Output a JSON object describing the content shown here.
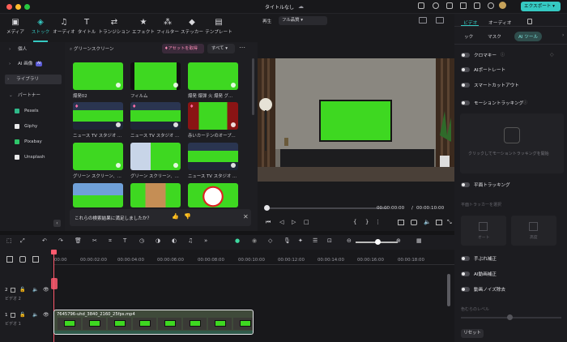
{
  "titlebar": {
    "title": "タイトルなし",
    "export_label": "エクスポート"
  },
  "toolbar": {
    "items": [
      {
        "label": "メディア",
        "icon": "media-icon"
      },
      {
        "label": "ストック",
        "icon": "stock-icon"
      },
      {
        "label": "オーディオ",
        "icon": "audio-icon"
      },
      {
        "label": "タイトル",
        "icon": "title-icon"
      },
      {
        "label": "トランジション",
        "icon": "transition-icon"
      },
      {
        "label": "エフェクト",
        "icon": "effect-icon"
      },
      {
        "label": "フィルター",
        "icon": "filter-icon"
      },
      {
        "label": "ステッカー",
        "icon": "sticker-icon"
      },
      {
        "label": "テンプレート",
        "icon": "template-icon"
      }
    ]
  },
  "sidebar": {
    "personal": "個人",
    "ai_image": "AI 画像",
    "ai_badge": "AI",
    "library": "ライブラリ",
    "partners": "パートナー",
    "providers": [
      "Pexels",
      "Giphy",
      "Pixabay",
      "Unsplash"
    ]
  },
  "search": {
    "value": "グリーンスクリーン",
    "asset_button": "アセットを取得",
    "filter": "すべて"
  },
  "assets": [
    {
      "caption": "爆発02"
    },
    {
      "caption": "フィルム"
    },
    {
      "caption": "爆発 爆弾 火 爆発 グ..."
    },
    {
      "caption": "ニュース TV スタジオ ..."
    },
    {
      "caption": "ニュース TV スタジオ ..."
    },
    {
      "caption": "赤いカーテンのオープ..."
    },
    {
      "caption": "グリーン スクリーン、..."
    },
    {
      "caption": "グリーン スクリーン、..."
    },
    {
      "caption": "ニュース TV スタジオ ..."
    }
  ],
  "feedback": {
    "question": "これらの検索結果に満足しましたか？"
  },
  "preview": {
    "tab": "再生",
    "quality": "フル品質",
    "current_time": "00:00:00:00",
    "separator": "/",
    "total_time": "00:00:10:00"
  },
  "right_panel": {
    "tabs": [
      "ビデオ",
      "オーディオ"
    ],
    "subtabs": [
      "ック",
      "マスク",
      "AI ツール"
    ],
    "tools": [
      "クロマキー",
      "AIポートレート",
      "スマートカットアウト",
      "モーショントラッキング"
    ],
    "tracking_hint": "クリックしてモーショントラッキングを開始",
    "plane_tracking": "平面トラッキング",
    "plane_select": "平面トラッカーを選択",
    "option_auto": "オート",
    "option_advanced": "高度",
    "tools2": [
      "手ぶれ補正",
      "AI動画補正",
      "動画ノイズ除去"
    ],
    "level_label": "色むらのレベル",
    "reset": "リセット"
  },
  "timeline": {
    "ticks": [
      "00:00",
      "00:00:02:00",
      "00:00:04:00",
      "00:00:06:00",
      "00:00:08:00",
      "00:00:10:00",
      "00:00:12:00",
      "00:00:14:00",
      "00:00:16:00",
      "00:00:18:00"
    ],
    "track2_label": "ビデオ 2",
    "track1_label": "ビデオ 1",
    "track2_num": "2",
    "track1_num": "1",
    "clip_name": "7645796-uhd_3840_2160_25fps.mp4"
  },
  "colors": {
    "accent": "#35c9c2",
    "green": "#3ed821",
    "playhead": "#ff5a6e"
  }
}
